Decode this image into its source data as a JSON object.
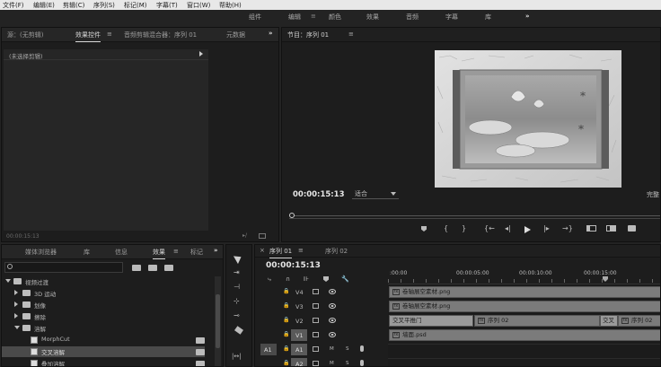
{
  "menubar": {
    "items": [
      "文件(F)",
      "编辑(E)",
      "剪辑(C)",
      "序列(S)",
      "标记(M)",
      "字幕(T)",
      "窗口(W)",
      "帮助(H)"
    ]
  },
  "workspaces": {
    "tabs": [
      "组件",
      "编辑",
      "颜色",
      "效果",
      "音频",
      "字幕",
      "库"
    ],
    "overflow": "»"
  },
  "source_panel": {
    "tabs": [
      "源：(无剪辑)",
      "效果控件",
      "音频剪辑混合器：序列 01",
      "元数据"
    ],
    "active_tab": "效果控件",
    "menu_icon": "≡",
    "overflow": "»",
    "no_clip_label": "(未选择剪辑)",
    "timecode": "00:00:15:13"
  },
  "program_monitor": {
    "title": "节目：序列 01",
    "menu_icon": "≡",
    "timecode": "00:00:15:13",
    "fit_select": "适合",
    "quality": "完整",
    "controls": [
      "marker-icon",
      "mark-in-icon",
      "mark-out-icon",
      "go-to-in-icon",
      "step-back-icon",
      "play-icon",
      "step-forward-icon",
      "go-to-out-icon",
      "insert-icon",
      "overwrite-icon",
      "export-frame-icon"
    ]
  },
  "project_panel": {
    "tabs": [
      "媒体浏览器",
      "库",
      "信息",
      "效果",
      "标记"
    ],
    "active_tab": "效果",
    "menu_icon": "≡",
    "overflow": "»",
    "search_placeholder": "",
    "tree": [
      {
        "label": "视频过渡",
        "level": 0,
        "expanded": true,
        "type": "folder"
      },
      {
        "label": "3D 运动",
        "level": 1,
        "expanded": false,
        "type": "folder"
      },
      {
        "label": "划像",
        "level": 1,
        "expanded": false,
        "type": "folder"
      },
      {
        "label": "擦除",
        "level": 1,
        "expanded": false,
        "type": "folder"
      },
      {
        "label": "溶解",
        "level": 1,
        "expanded": true,
        "type": "folder"
      },
      {
        "label": "MorphCut",
        "level": 2,
        "type": "effect",
        "selected": false
      },
      {
        "label": "交叉溶解",
        "level": 2,
        "type": "effect",
        "selected": true
      },
      {
        "label": "叠加溶解",
        "level": 2,
        "type": "effect",
        "selected": false
      }
    ]
  },
  "tools": [
    "selection-tool-icon",
    "track-select-icon",
    "ripple-edit-icon",
    "rolling-edit-icon",
    "rate-stretch-icon",
    "razor-icon",
    "slip-icon"
  ],
  "timeline": {
    "tabs": [
      "序列 01",
      "序列 02"
    ],
    "active_tab": "序列 01",
    "menu_icon": "≡",
    "close": "×",
    "timecode": "00:00:15:13",
    "ruler": [
      ":00:00",
      "00:00:05:00",
      "00:00:10:00",
      "00:00:15:00"
    ],
    "tracks": [
      {
        "name": "V4",
        "source": "",
        "kind": "video"
      },
      {
        "name": "V3",
        "source": "",
        "kind": "video"
      },
      {
        "name": "V2",
        "source": "",
        "kind": "video"
      },
      {
        "name": "V1",
        "source": "",
        "kind": "video"
      },
      {
        "name": "A1",
        "source": "A1",
        "kind": "audio",
        "m": "M",
        "s": "S"
      },
      {
        "name": "A2",
        "source": "",
        "kind": "audio",
        "m": "M",
        "s": "S"
      }
    ],
    "clips": {
      "v4": "卷轴展空素材.png",
      "v3": "卷轴展空素材.png",
      "v2_transition": "交叉平推门",
      "v2_clip": "序列 02",
      "v2_transition_b": "交叉",
      "v2_clip_b": "序列 02",
      "v1": "墙面.psd"
    }
  }
}
